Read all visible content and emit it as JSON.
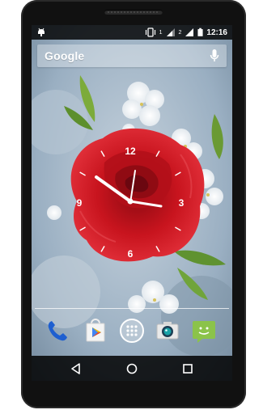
{
  "status_bar": {
    "time": "12:16",
    "sim1_label": "1",
    "sim2_label": "2",
    "icons": [
      "android-notification-icon",
      "vibrate-icon",
      "signal-icon",
      "signal-icon",
      "battery-icon"
    ]
  },
  "search_widget": {
    "label": "Google",
    "icons": [
      "mic-icon"
    ]
  },
  "clock_widget": {
    "dial_numbers": [
      "12",
      "3",
      "6",
      "9"
    ],
    "time_shown": "10:15"
  },
  "dock": {
    "apps": [
      "phone-icon",
      "play-store-icon",
      "app-drawer-icon",
      "camera-icon",
      "messaging-icon"
    ]
  },
  "nav_bar": {
    "icons": [
      "back-icon",
      "home-icon",
      "recents-icon"
    ]
  },
  "colors": {
    "rose": "#c8141e",
    "statusbar": "#000000",
    "navbar": "#000000"
  }
}
